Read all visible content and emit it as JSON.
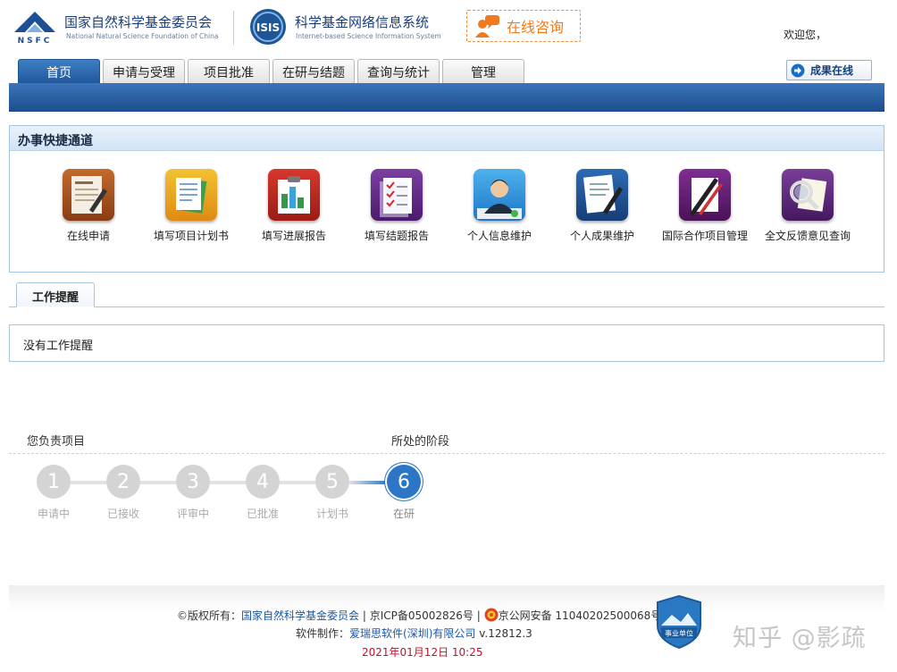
{
  "header": {
    "org_cn": "国家自然科学基金委员会",
    "org_en": "National Natural Science Foundation of China",
    "logo_text": "NSFC",
    "isis_text": "ISIS",
    "system_cn": "科学基金网络信息系统",
    "system_en": "Internet-based Science Information System",
    "consult_label": "在线咨询",
    "welcome": "欢迎您，"
  },
  "nav": {
    "tabs": [
      {
        "label": "首页",
        "active": true
      },
      {
        "label": "申请与受理"
      },
      {
        "label": "项目批准"
      },
      {
        "label": "在研与结题"
      },
      {
        "label": "查询与统计"
      },
      {
        "label": "管理"
      }
    ],
    "results_label": "成果在线"
  },
  "shortcuts": {
    "title": "办事快捷通道",
    "items": [
      {
        "label": "在线申请",
        "icon": "online-apply-icon"
      },
      {
        "label": "填写项目计划书",
        "icon": "project-plan-icon"
      },
      {
        "label": "填写进展报告",
        "icon": "progress-report-icon"
      },
      {
        "label": "填写结题报告",
        "icon": "final-report-icon"
      },
      {
        "label": "个人信息维护",
        "icon": "personal-info-icon"
      },
      {
        "label": "个人成果维护",
        "icon": "personal-results-icon"
      },
      {
        "label": "国际合作项目管理",
        "icon": "intl-cooperation-icon"
      },
      {
        "label": "全文反馈意见查询",
        "icon": "feedback-query-icon"
      }
    ]
  },
  "work": {
    "tab_label": "工作提醒",
    "message": "没有工作提醒"
  },
  "stages": {
    "my_projects_label": "您负责项目",
    "current_stage_label": "所处的阶段",
    "steps": [
      {
        "num": "1",
        "label": "申请中"
      },
      {
        "num": "2",
        "label": "已接收"
      },
      {
        "num": "3",
        "label": "评审中"
      },
      {
        "num": "4",
        "label": "已批准"
      },
      {
        "num": "5",
        "label": "计划书"
      },
      {
        "num": "6",
        "label": "在研",
        "current": true
      }
    ]
  },
  "footer": {
    "copyright_prefix": "©版权所有：",
    "owner": "国家自然科学基金委员会",
    "icp": " | 京ICP备05002826号 | ",
    "police": "京公网安备 11040202500068号",
    "maker_prefix": "软件制作：",
    "maker": "爱瑞思软件(深圳)有限公司",
    "version": " v.12812.3",
    "datetime": "2021年01月12日 10:25",
    "badge_text": "事业单位",
    "watermark": "知乎 @影疏"
  },
  "colors": {
    "brand_blue": "#1d5597",
    "consult_orange": "#f07a1e",
    "current_step": "#2c76c5",
    "date_red": "#c0102a"
  }
}
